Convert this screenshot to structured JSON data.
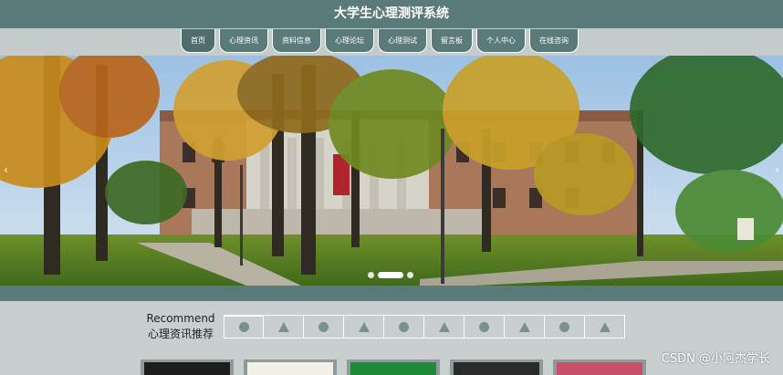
{
  "header": {
    "title": "大学生心理测评系统"
  },
  "nav": {
    "items": [
      {
        "label": "首页"
      },
      {
        "label": "心理资讯"
      },
      {
        "label": "资料信息"
      },
      {
        "label": "心理论坛"
      },
      {
        "label": "心理测试"
      },
      {
        "label": "留言板"
      },
      {
        "label": "个人中心"
      },
      {
        "label": "在线咨询"
      }
    ]
  },
  "carousel": {
    "slide_count": 3,
    "active_slide": 2,
    "prev_icon": "chevron-left-icon",
    "next_icon": "chevron-right-icon"
  },
  "recommend": {
    "title_en": "Recommend",
    "title_zh": "心理资讯推荐",
    "tabs": [
      {
        "icon": "circle-icon"
      },
      {
        "icon": "triangle-icon"
      },
      {
        "icon": "circle-icon"
      },
      {
        "icon": "triangle-icon"
      },
      {
        "icon": "circle-icon"
      },
      {
        "icon": "triangle-icon"
      },
      {
        "icon": "circle-icon"
      },
      {
        "icon": "triangle-icon"
      },
      {
        "icon": "circle-icon"
      },
      {
        "icon": "triangle-icon"
      }
    ]
  },
  "thumbnails": {
    "count": 5
  },
  "watermark": {
    "text": "CSDN @小阿杰学长"
  },
  "colors": {
    "accent": "#5b7b7a",
    "band": "#c3cbcb",
    "background": "#c9cfcf"
  }
}
